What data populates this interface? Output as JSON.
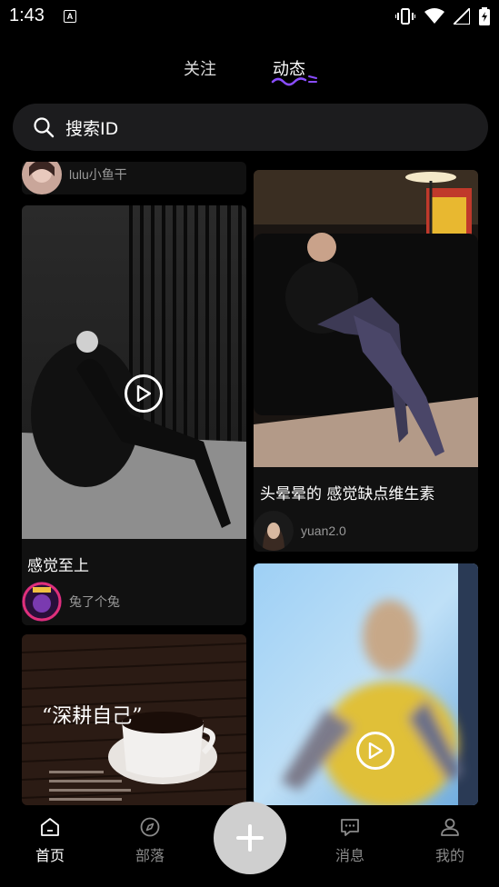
{
  "status_bar": {
    "time": "1:43",
    "notification_letter": "A"
  },
  "tabs": [
    {
      "label": "关注",
      "active": false
    },
    {
      "label": "动态",
      "active": true
    }
  ],
  "search": {
    "placeholder": "搜索ID"
  },
  "feed": {
    "partial_card": {
      "author": "lulu小鱼干"
    },
    "cards": [
      {
        "title": "感觉至上",
        "author": "兔了个兔",
        "is_video": true
      },
      {
        "title": "头晕晕的 感觉缺点维生素",
        "author": "yuan2.0",
        "is_video": false
      },
      {
        "caption": "“深耕自己”",
        "is_video": false
      },
      {
        "is_video": true
      }
    ]
  },
  "bottom_nav": [
    {
      "label": "首页",
      "icon": "home-icon",
      "active": true
    },
    {
      "label": "部落",
      "icon": "compass-icon",
      "active": false
    },
    {
      "label": "消息",
      "icon": "message-icon",
      "active": false
    },
    {
      "label": "我的",
      "icon": "profile-icon",
      "active": false
    }
  ],
  "fab": {
    "icon": "plus-icon"
  },
  "colors": {
    "background": "#000000",
    "card": "#111111",
    "search": "#1c1c1e",
    "fab": "#cfcfcf",
    "accent": "#8a4dff"
  }
}
